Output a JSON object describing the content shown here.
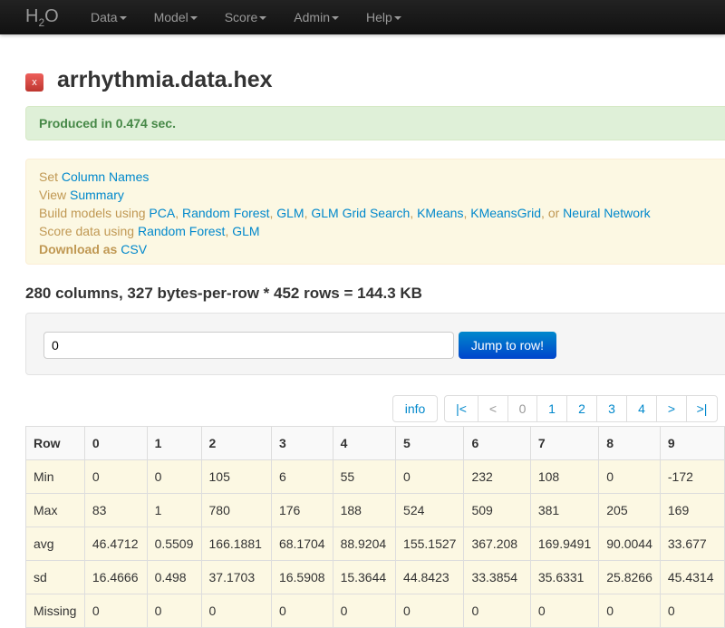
{
  "nav": {
    "brand": "H",
    "brand_sub": "2",
    "brand_end": "O",
    "menus": [
      "Data",
      "Model",
      "Score",
      "Admin",
      "Help"
    ]
  },
  "title": "arrhythmia.data.hex",
  "close_label": "x",
  "alert": "Produced in 0.474 sec.",
  "actions": {
    "set": "Set",
    "column_names": "Column Names",
    "view": "View",
    "summary": "Summary",
    "build": "Build models using",
    "models": [
      "PCA",
      "Random Forest",
      "GLM",
      "GLM Grid Search",
      "KMeans",
      "KMeansGrid"
    ],
    "or": "or",
    "nn": "Neural Network",
    "score": "Score data using",
    "score_models": [
      "Random Forest",
      "GLM"
    ],
    "download": "Download as",
    "csv": "CSV"
  },
  "size_summary": "280 columns, 327 bytes-per-row * 452 rows = 144.3 KB",
  "jump": {
    "value": "0",
    "button": "Jump to row!"
  },
  "pager": {
    "info": "info",
    "pages": [
      "|<",
      "<",
      "0",
      "1",
      "2",
      "3",
      "4",
      ">",
      ">|"
    ]
  },
  "table": {
    "headers": [
      "Row",
      "0",
      "1",
      "2",
      "3",
      "4",
      "5",
      "6",
      "7",
      "8",
      "9"
    ],
    "rows": [
      [
        "Min",
        "0",
        "0",
        "105",
        "6",
        "55",
        "0",
        "232",
        "108",
        "0",
        "-172"
      ],
      [
        "Max",
        "83",
        "1",
        "780",
        "176",
        "188",
        "524",
        "509",
        "381",
        "205",
        "169"
      ],
      [
        "avg",
        "46.4712",
        "0.5509",
        "166.1881",
        "68.1704",
        "88.9204",
        "155.1527",
        "367.208",
        "169.9491",
        "90.0044",
        "33.677"
      ],
      [
        "sd",
        "16.4666",
        "0.498",
        "37.1703",
        "16.5908",
        "15.3644",
        "44.8423",
        "33.3854",
        "35.6331",
        "25.8266",
        "45.4314"
      ],
      [
        "Missing",
        "0",
        "0",
        "0",
        "0",
        "0",
        "0",
        "0",
        "0",
        "0",
        "0"
      ]
    ]
  }
}
